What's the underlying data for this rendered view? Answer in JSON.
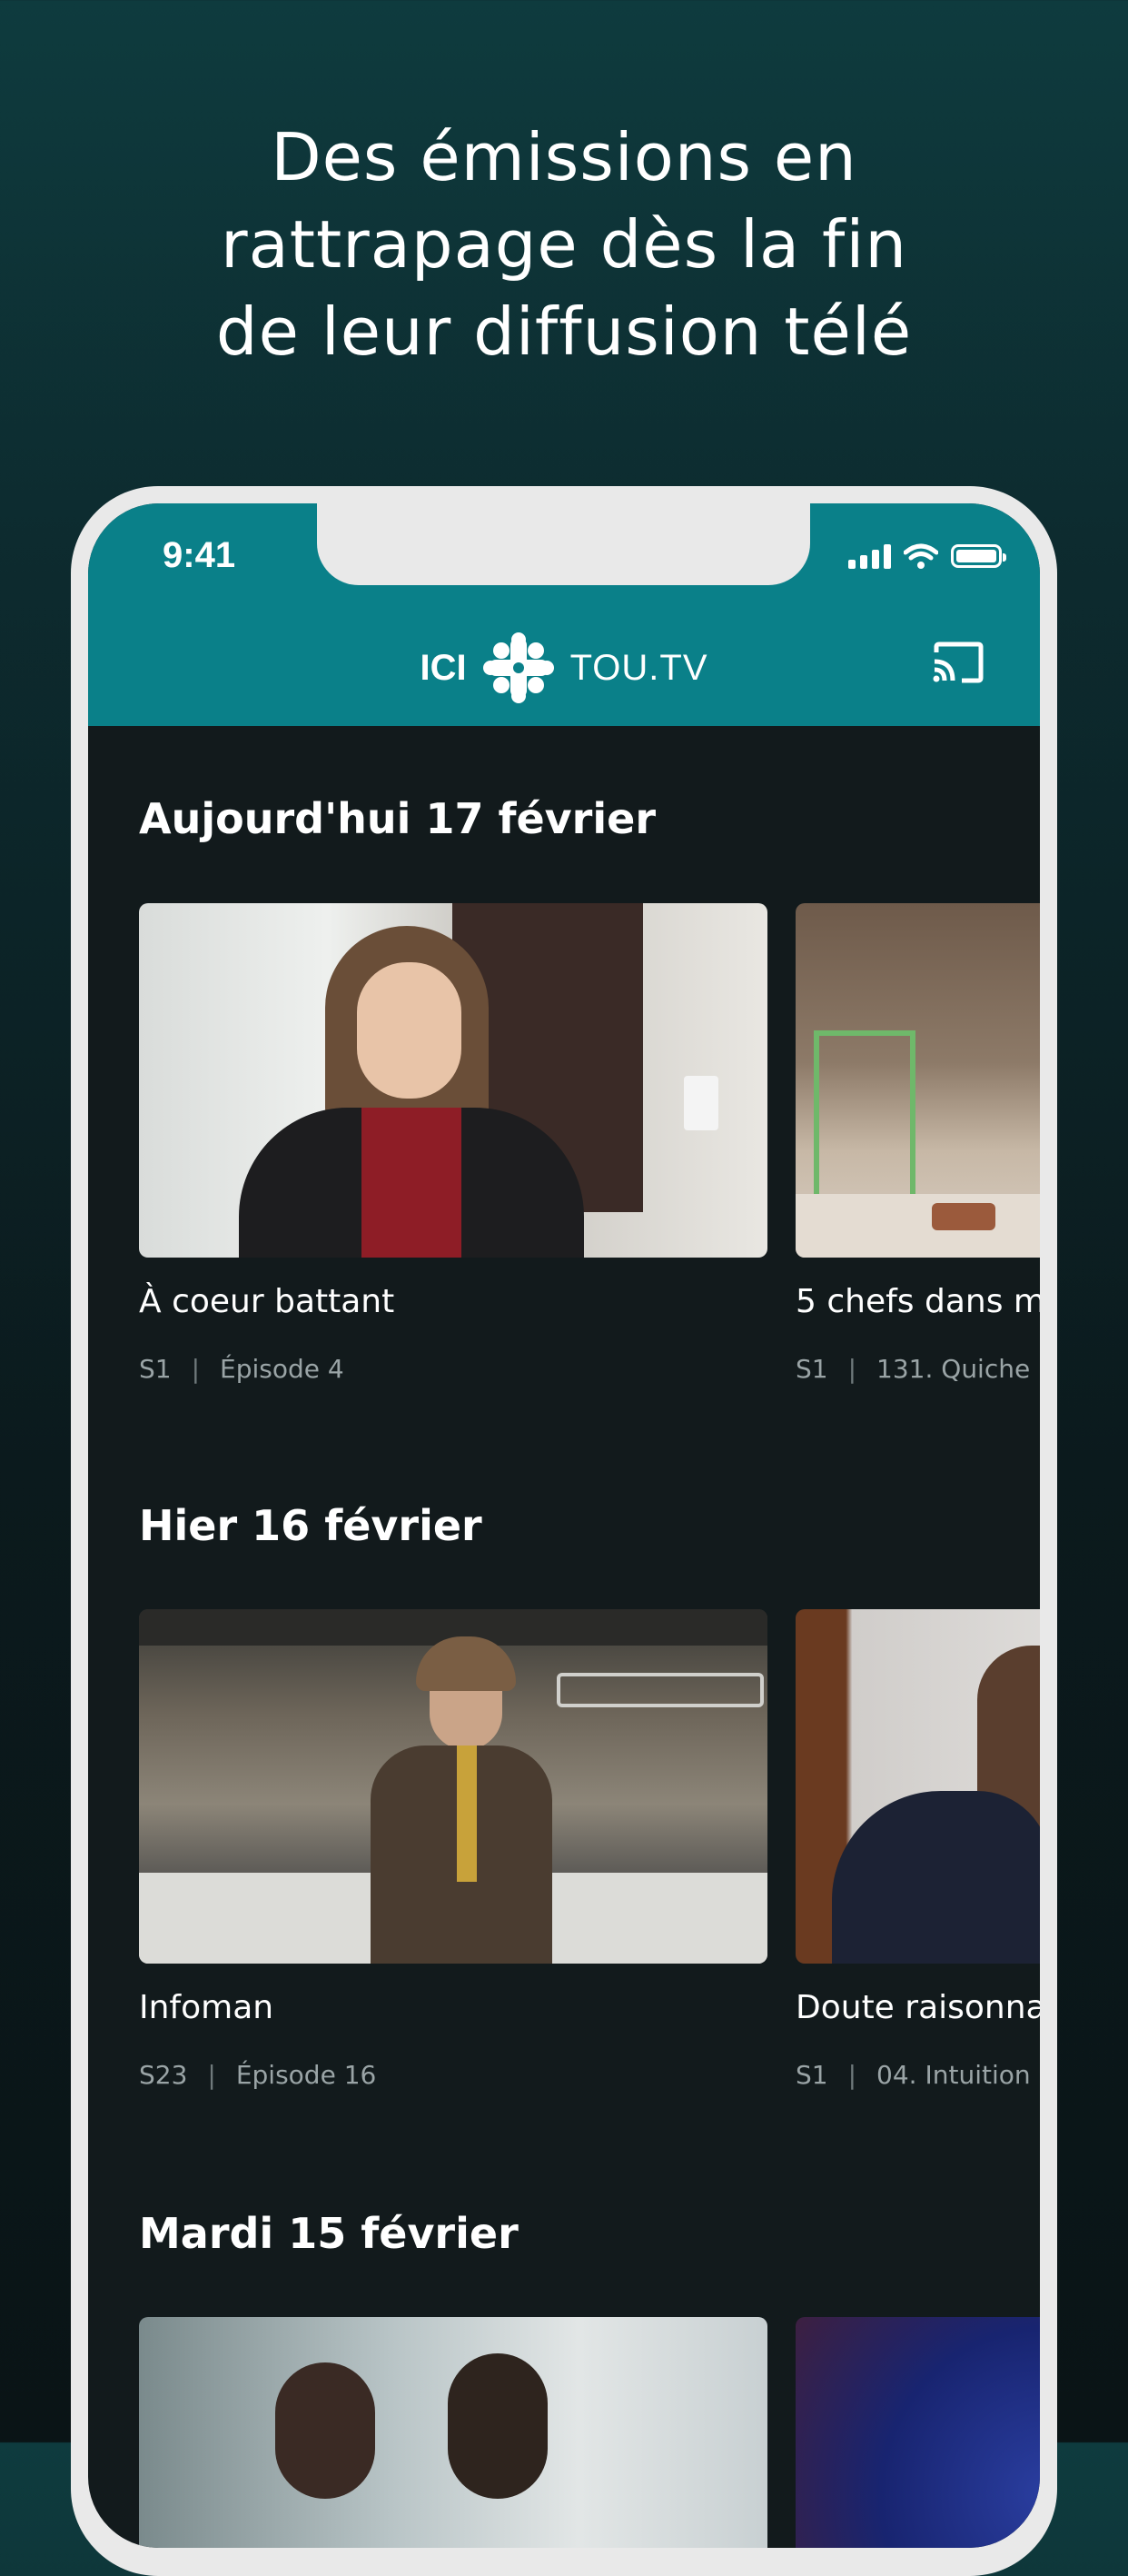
{
  "headline": {
    "line1": "Des émissions en",
    "line2": "rattrapage dès la fin",
    "line3": "de leur diffusion télé"
  },
  "status_bar": {
    "time": "9:41",
    "icons": [
      "signal-icon",
      "wifi-icon",
      "battery-icon"
    ]
  },
  "app_bar": {
    "logo_left": "ICI",
    "logo_right": "TOU.TV",
    "cast_icon": "cast-icon"
  },
  "colors": {
    "app_bar": "#0a8089",
    "screen_bg": "#121a1c",
    "meta_text": "#9aa4a6"
  },
  "sections": [
    {
      "title": "Aujourd'hui 17 février",
      "cards": [
        {
          "title": "À coeur battant",
          "season": "S1",
          "episode": "Épisode 4"
        },
        {
          "title": "5 chefs dans m",
          "season": "S1",
          "episode": "131. Quiche"
        }
      ]
    },
    {
      "title": "Hier 16 février",
      "cards": [
        {
          "title": "Infoman",
          "season": "S23",
          "episode": "Épisode 16"
        },
        {
          "title": "Doute raisonna",
          "season": "S1",
          "episode": "04. Intuition"
        }
      ]
    },
    {
      "title": "Mardi 15 février",
      "cards": [
        {
          "title": "",
          "season": "",
          "episode": ""
        },
        {
          "title": "",
          "season": "",
          "episode": ""
        }
      ]
    }
  ]
}
